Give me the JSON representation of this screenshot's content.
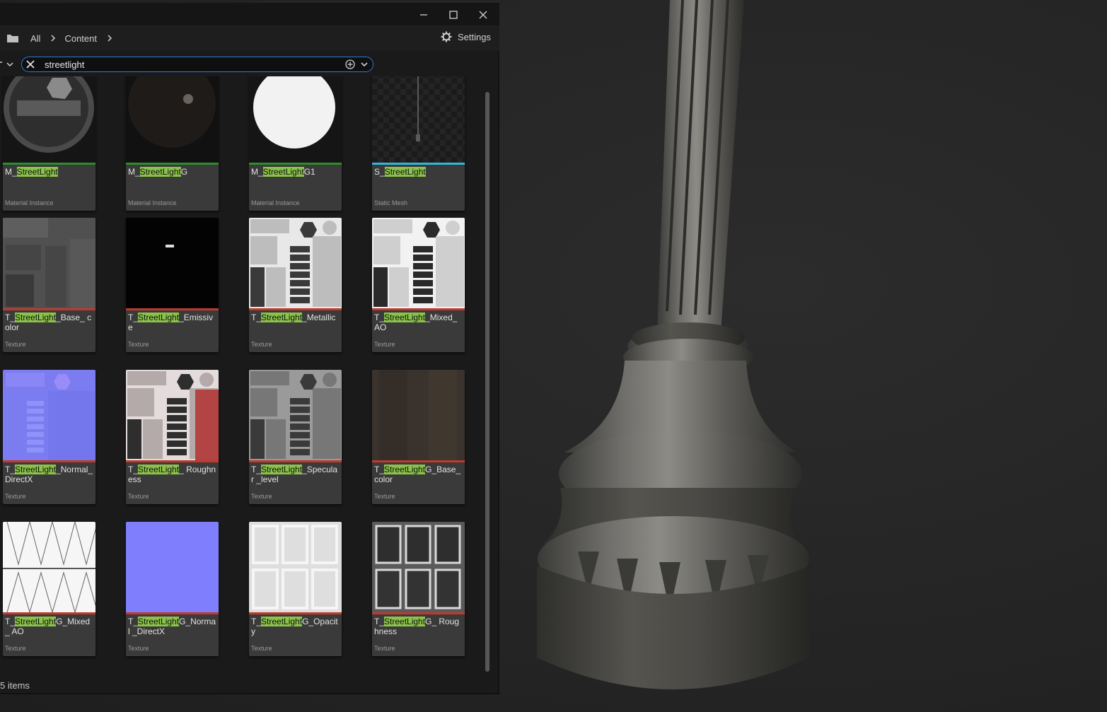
{
  "window": {
    "controls": [
      "minimize-icon",
      "maximize-icon",
      "close-icon"
    ]
  },
  "pathbar": {
    "crumbs": [
      "All",
      "Content"
    ],
    "settings_label": "Settings"
  },
  "search": {
    "value": "streetlight"
  },
  "highlight_term": "StreetLight",
  "assets": [
    {
      "prefix": "M_",
      "match": "StreetLight",
      "suffix": "",
      "type": "Material Instance",
      "bar": "#2e8b2e",
      "thumb": "sphere-metal"
    },
    {
      "prefix": "M_",
      "match": "StreetLight",
      "suffix": "G",
      "type": "Material Instance",
      "bar": "#2e8b2e",
      "thumb": "sphere-dark"
    },
    {
      "prefix": "M_",
      "match": "StreetLight",
      "suffix": "G1",
      "type": "Material Instance",
      "bar": "#2e8b2e",
      "thumb": "sphere-white"
    },
    {
      "prefix": "S_",
      "match": "StreetLight",
      "suffix": "",
      "type": "Static Mesh",
      "bar": "#35b6d8",
      "thumb": "mesh"
    },
    {
      "prefix": "T_",
      "match": "StreetLight",
      "suffix": "_Base_ color",
      "type": "Texture",
      "bar": "#c0392b",
      "thumb": "base-color"
    },
    {
      "prefix": "T_",
      "match": "StreetLight",
      "suffix": "_Emissive",
      "type": "Texture",
      "bar": "#c0392b",
      "thumb": "emissive"
    },
    {
      "prefix": "T_",
      "match": "StreetLight",
      "suffix": "_Metallic",
      "type": "Texture",
      "bar": "#c0392b",
      "thumb": "metallic"
    },
    {
      "prefix": "T_",
      "match": "StreetLight",
      "suffix": "_Mixed_ AO",
      "type": "Texture",
      "bar": "#c0392b",
      "thumb": "mixed-ao"
    },
    {
      "prefix": "T_",
      "match": "StreetLight",
      "suffix": "_Normal_ DirectX",
      "type": "Texture",
      "bar": "#c0392b",
      "thumb": "normal"
    },
    {
      "prefix": "T_",
      "match": "StreetLight",
      "suffix": "_ Roughness",
      "type": "Texture",
      "bar": "#c0392b",
      "thumb": "roughness"
    },
    {
      "prefix": "T_",
      "match": "StreetLight",
      "suffix": "_Specular _level",
      "type": "Texture",
      "bar": "#c0392b",
      "thumb": "specular"
    },
    {
      "prefix": "T_",
      "match": "StreetLight",
      "suffix": "G_Base_ color",
      "type": "Texture",
      "bar": "#c0392b",
      "thumb": "g-base"
    },
    {
      "prefix": "T_",
      "match": "StreetLight",
      "suffix": "G_Mixed_ AO",
      "type": "Texture",
      "bar": "#c0392b",
      "thumb": "g-ao"
    },
    {
      "prefix": "T_",
      "match": "StreetLight",
      "suffix": "G_Normal _DirectX",
      "type": "Texture",
      "bar": "#c0392b",
      "thumb": "g-normal"
    },
    {
      "prefix": "T_",
      "match": "StreetLight",
      "suffix": "G_Opacity",
      "type": "Texture",
      "bar": "#c0392b",
      "thumb": "g-opacity"
    },
    {
      "prefix": "T_",
      "match": "StreetLight",
      "suffix": "G_ Roughness",
      "type": "Texture",
      "bar": "#c0392b",
      "thumb": "g-rough"
    }
  ],
  "status": {
    "item_count": "5 items"
  },
  "colors": {
    "search_focus": "#2a7ad9",
    "highlight": "#8bc34a",
    "material_bar": "#2e8b2e",
    "mesh_bar": "#35b6d8",
    "texture_bar": "#c0392b"
  }
}
